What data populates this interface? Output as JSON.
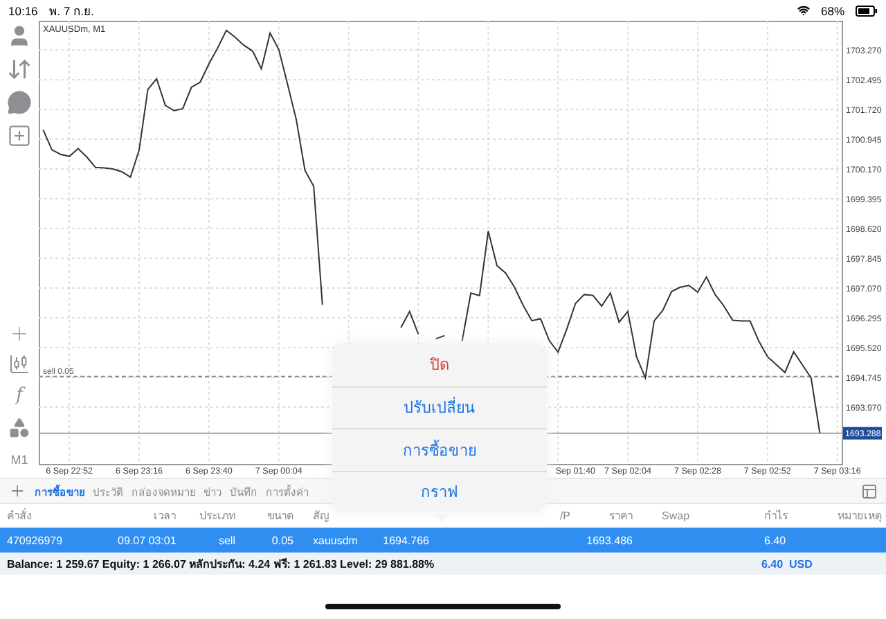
{
  "status_bar": {
    "time": "10:16",
    "date": "พ. 7 ก.ย.",
    "battery": "68%"
  },
  "toolbar": {
    "indicator_label": "f",
    "timeframe": "M1"
  },
  "chart": {
    "chart_data": {
      "type": "line",
      "title": "XAUUSDm, M1",
      "grid": true,
      "ylim": [
        1692.49,
        1704.03
      ],
      "categories": [
        null,
        null,
        null,
        "6 Sep 22:52",
        null,
        null,
        null,
        null,
        null,
        null,
        null,
        "6 Sep 23:16",
        null,
        null,
        null,
        null,
        null,
        null,
        null,
        "6 Sep 23:40",
        null,
        null,
        null,
        null,
        null,
        null,
        null,
        "7 Sep 00:04",
        null,
        null,
        null,
        null,
        null,
        null,
        null,
        null,
        null,
        null,
        null,
        null,
        null,
        null,
        null,
        null,
        null,
        null,
        null,
        null,
        null,
        null,
        null,
        null,
        null,
        null,
        null,
        null,
        null,
        null,
        null,
        null,
        null,
        "Sep 01:40",
        null,
        null,
        null,
        null,
        null,
        "7 Sep 02:04",
        null,
        null,
        null,
        null,
        null,
        null,
        null,
        "7 Sep 02:28",
        null,
        null,
        null,
        null,
        null,
        null,
        null,
        "7 Sep 02:52",
        null,
        null,
        null,
        null,
        null,
        null,
        null,
        "7 Sep 03:16"
      ],
      "series": [
        {
          "color": "#333333",
          "values": [
            1701.19,
            1700.67,
            1700.55,
            1700.5,
            1700.7,
            1700.48,
            1700.21,
            1700.2,
            1700.17,
            1700.1,
            1699.96,
            1700.66,
            1702.24,
            1702.52,
            1701.83,
            1701.69,
            1701.74,
            1702.3,
            1702.43,
            1702.91,
            1703.32,
            1703.78,
            1703.6,
            1703.39,
            1703.24,
            1702.78,
            1703.71,
            1703.28,
            1702.38,
            1701.46,
            1700.13,
            1699.72,
            1696.63,
            null,
            null,
            null,
            null,
            null,
            null,
            null,
            null,
            1696.04,
            1696.46,
            1695.87,
            null,
            1695.75,
            1695.83,
            null,
            1695.69,
            1696.94,
            1696.87,
            1698.55,
            1697.65,
            1697.46,
            1697.09,
            1696.62,
            1696.22,
            1696.27,
            1695.7,
            1695.4,
            1696.0,
            1696.67,
            1696.9,
            1696.88,
            1696.6,
            1696.94,
            1696.18,
            1696.46,
            1695.28,
            1694.73,
            1696.21,
            1696.49,
            1696.98,
            1697.09,
            1697.14,
            1696.96,
            1697.36,
            1696.9,
            1696.6,
            1696.23,
            1696.21,
            1696.21,
            1695.69,
            1695.28,
            1695.08,
            1694.87,
            1695.41,
            1695.07,
            1694.73,
            1693.29,
            null,
            null
          ]
        }
      ],
      "yticks": [
        {
          "value": 1703.27,
          "label": "1703.270"
        },
        {
          "value": 1702.495,
          "label": "1702.495"
        },
        {
          "value": 1701.72,
          "label": "1701.720"
        },
        {
          "value": 1700.945,
          "label": "1700.945"
        },
        {
          "value": 1700.17,
          "label": "1700.170"
        },
        {
          "value": 1699.395,
          "label": "1699.395"
        },
        {
          "value": 1698.62,
          "label": "1698.620"
        },
        {
          "value": 1697.845,
          "label": "1697.845"
        },
        {
          "value": 1697.07,
          "label": "1697.070"
        },
        {
          "value": 1696.295,
          "label": "1696.295"
        },
        {
          "value": 1695.52,
          "label": "1695.520"
        },
        {
          "value": 1694.745,
          "label": "1694.745"
        },
        {
          "value": 1693.97,
          "label": "1693.970"
        }
      ],
      "ref_lines": [
        {
          "axis": "y",
          "value": 1694.766,
          "label": "sell 0.05"
        },
        {
          "axis": "y",
          "value": 1693.288,
          "label": "1693.288"
        }
      ]
    }
  },
  "popup_menu": [
    {
      "label": "ปิด",
      "kind": "destructive"
    },
    {
      "label": "ปรับเปลี่ยน",
      "kind": "action"
    },
    {
      "label": "การซื้อขาย",
      "kind": "action"
    },
    {
      "label": "กราฟ",
      "kind": "action"
    }
  ],
  "tabs": [
    {
      "label": "การซื้อขาย",
      "selected": true
    },
    {
      "label": "ประวัติ",
      "selected": false
    },
    {
      "label": "กล่องจดหมาย",
      "selected": false
    },
    {
      "label": "ข่าว",
      "selected": false
    },
    {
      "label": "บันทึก",
      "selected": false
    },
    {
      "label": "การตั้งค่า",
      "selected": false
    }
  ],
  "table": {
    "columns": [
      "คำสั่ง",
      "เวลา",
      "ประเภท",
      "ขนาด",
      "สัญ",
      null,
      null,
      "/P",
      "ราคา",
      "Swap",
      "กำไร",
      "หมายเหตุ"
    ],
    "rows": [
      {
        "selected": true,
        "cells": [
          "470926979",
          "09.07 03:01",
          "sell",
          "0.05",
          "xauusdm",
          "1694.766",
          "",
          "",
          "1693.486",
          "",
          "6.40",
          ""
        ]
      }
    ]
  },
  "summary": {
    "text": "Balance: 1 259.67 Equity: 1 266.07 หลักประกัน: 4.24 ฟรี: 1 261.83 Level: 29 881.88%",
    "profit": "6.40",
    "currency": "USD"
  }
}
